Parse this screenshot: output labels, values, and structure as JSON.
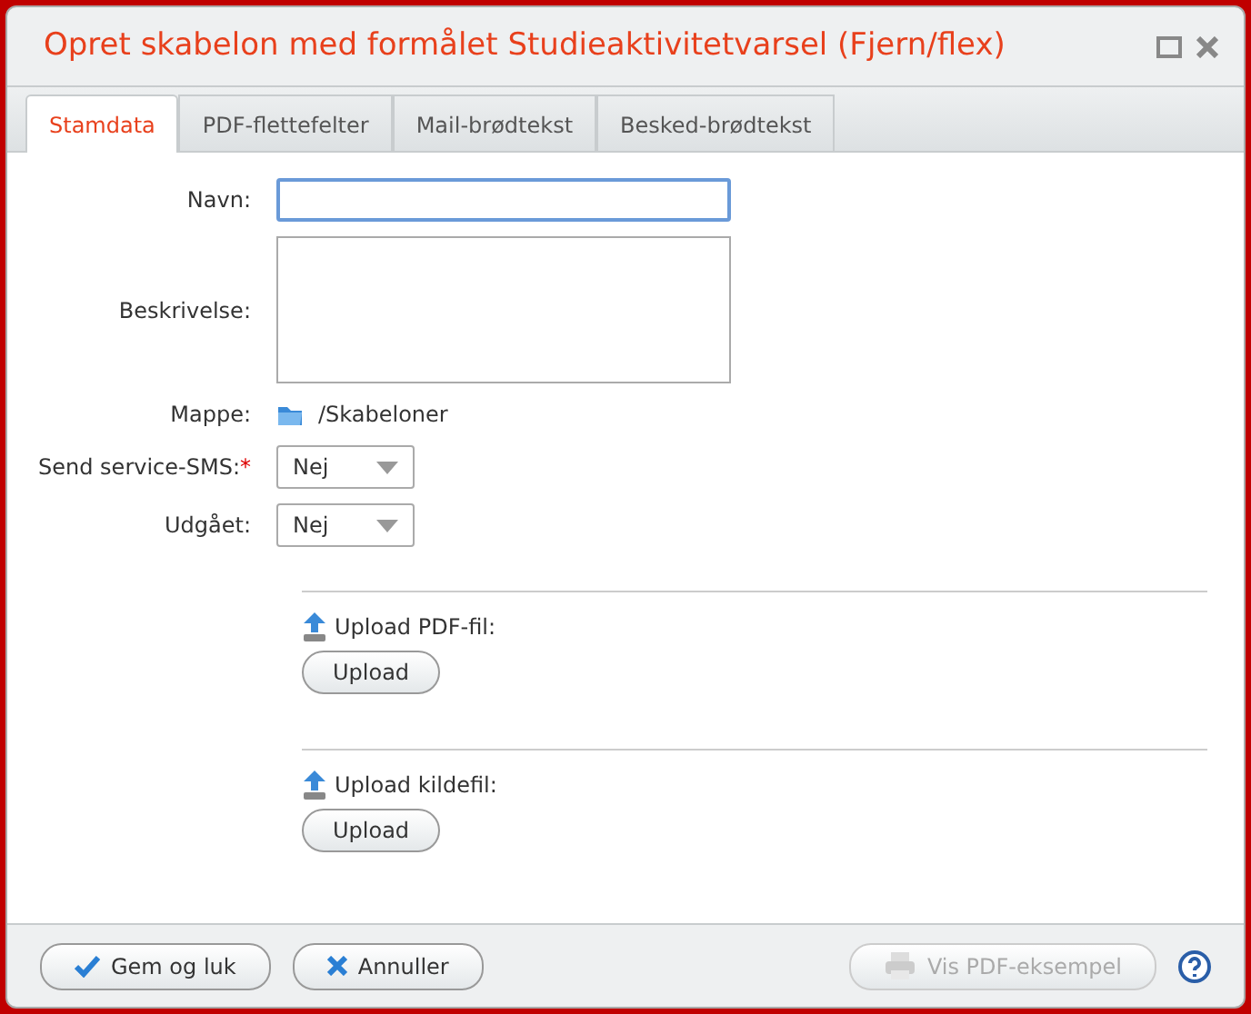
{
  "window": {
    "title": "Opret skabelon med formålet Studieaktivitetvarsel (Fjern/flex)"
  },
  "tabs": [
    {
      "label": "Stamdata",
      "selected": true
    },
    {
      "label": "PDF-flettefelter",
      "selected": false
    },
    {
      "label": "Mail-brødtekst",
      "selected": false
    },
    {
      "label": "Besked-brødtekst",
      "selected": false
    }
  ],
  "fields": [
    {
      "kind": "text",
      "label": "Navn:",
      "focused": true
    },
    {
      "kind": "textarea",
      "label": "Beskrivelse:"
    },
    {
      "kind": "folder",
      "label": "Mappe:",
      "value": "/Skabeloner"
    },
    {
      "kind": "select",
      "label": "Send service-SMS:",
      "required_mark": "*",
      "value": "Nej"
    },
    {
      "kind": "select",
      "label": "Udgået:",
      "value": "Nej"
    }
  ],
  "uploads": [
    {
      "label": "Upload PDF-fil:",
      "button": "Upload"
    },
    {
      "label": "Upload kildefil:",
      "button": "Upload"
    }
  ],
  "footer_buttons": [
    {
      "kind": "save",
      "label": "Gem og luk",
      "disabled": false
    },
    {
      "kind": "cancel",
      "label": "Annuller",
      "disabled": false
    },
    {
      "kind": "preview",
      "label": "Vis PDF-eksempel",
      "disabled": true
    }
  ]
}
